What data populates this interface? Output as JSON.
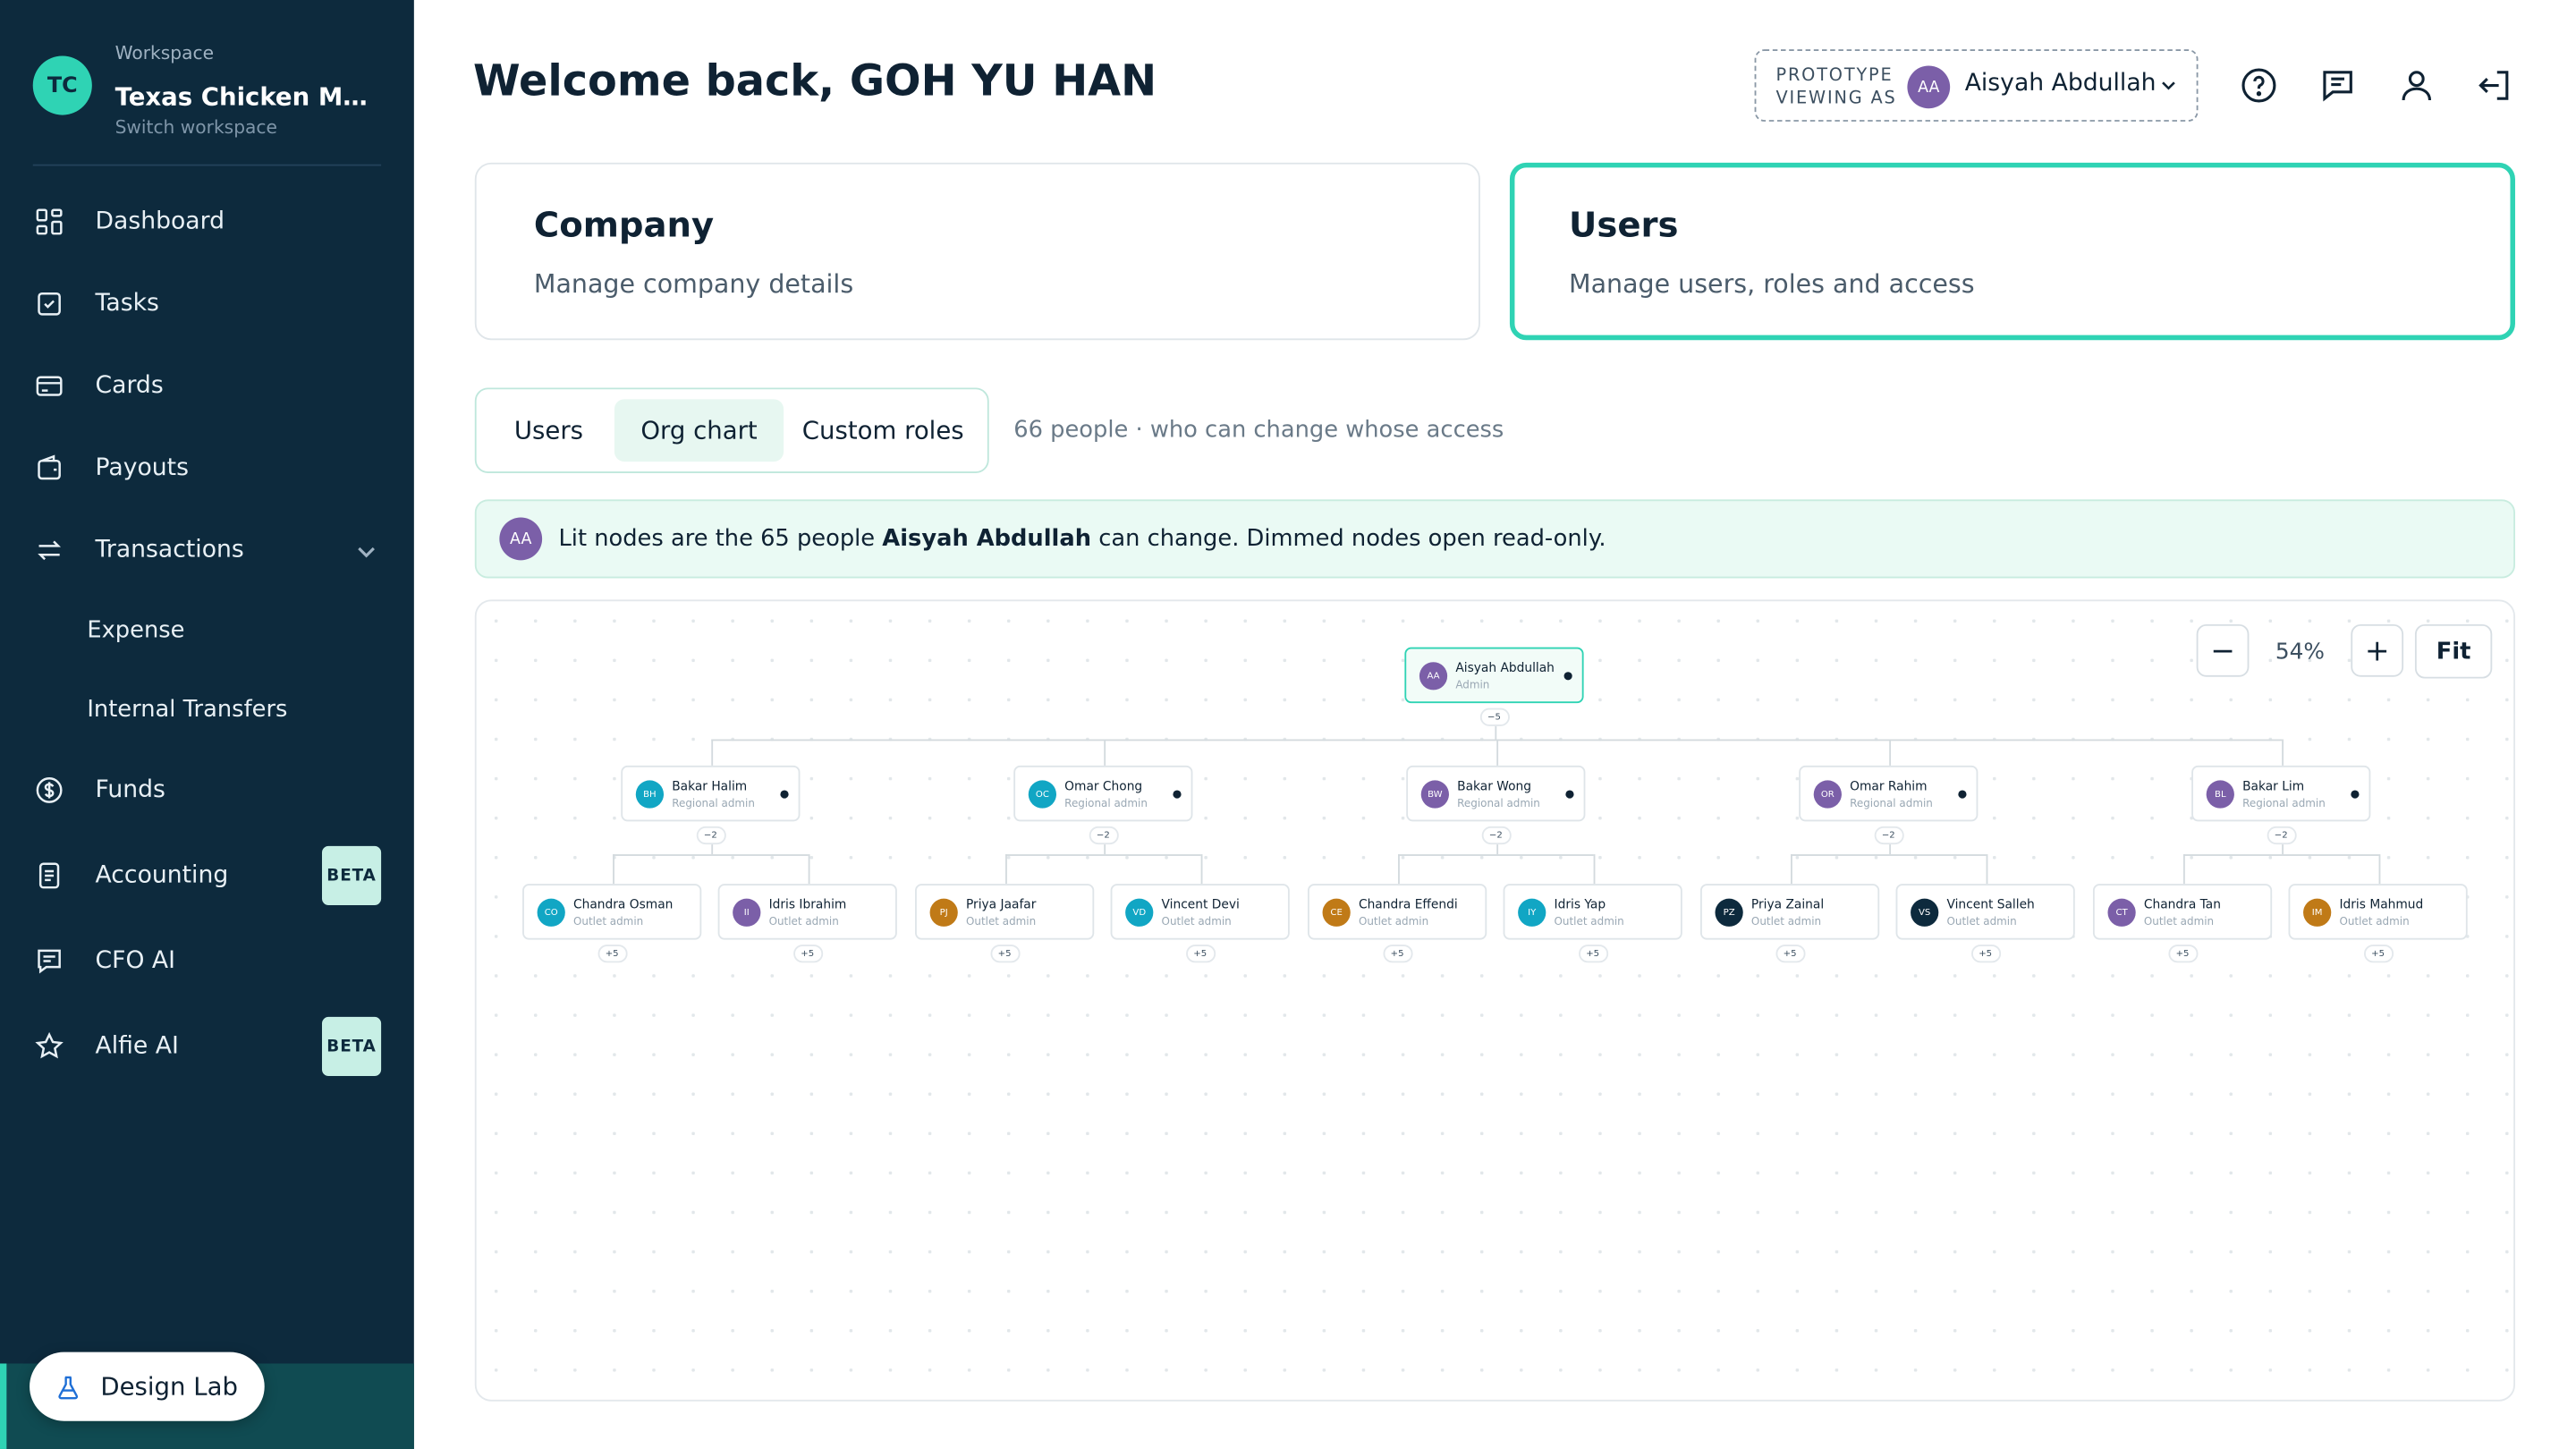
{
  "workspace": {
    "label": "Workspace",
    "name": "Texas Chicken Mala...",
    "switch": "Switch workspace",
    "initials": "TC"
  },
  "nav": {
    "dashboard": "Dashboard",
    "tasks": "Tasks",
    "cards": "Cards",
    "payouts": "Payouts",
    "transactions": "Transactions",
    "expense": "Expense",
    "internal_transfers": "Internal Transfers",
    "funds": "Funds",
    "accounting": "Accounting",
    "cfo_ai": "CFO AI",
    "alfie_ai": "Alfie AI",
    "beta": "BETA"
  },
  "design_lab": "Design Lab",
  "header": {
    "title": "Welcome back, GOH YU HAN"
  },
  "prototype": {
    "label": "PROTOTYPE VIEWING AS",
    "initials": "AA",
    "name": "Aisyah Abdullah"
  },
  "cards": {
    "company": {
      "title": "Company",
      "subtitle": "Manage company details"
    },
    "users": {
      "title": "Users",
      "subtitle": "Manage users, roles and access"
    }
  },
  "tabs": {
    "users": "Users",
    "org_chart": "Org chart",
    "custom_roles": "Custom roles",
    "note": "66 people · who can change whose access"
  },
  "banner": {
    "initials": "AA",
    "pre": "Lit nodes are the 65 people ",
    "name": "Aisyah Abdullah",
    "post": " can change. Dimmed nodes open read-only."
  },
  "zoom": {
    "minus": "−",
    "value": "54%",
    "plus": "+",
    "fit": "Fit"
  },
  "org": {
    "root": {
      "initials": "AA",
      "name": "Aisyah Abdullah",
      "role": "Admin",
      "count": "−5",
      "color": "#7b5fa8"
    },
    "regional": [
      {
        "initials": "BH",
        "name": "Bakar Halim",
        "role": "Regional admin",
        "count": "−2",
        "color": "#11a6c4"
      },
      {
        "initials": "OC",
        "name": "Omar Chong",
        "role": "Regional admin",
        "count": "−2",
        "color": "#11a6c4"
      },
      {
        "initials": "BW",
        "name": "Bakar Wong",
        "role": "Regional admin",
        "count": "−2",
        "color": "#7b5fa8"
      },
      {
        "initials": "OR",
        "name": "Omar Rahim",
        "role": "Regional admin",
        "count": "−2",
        "color": "#7b5fa8"
      },
      {
        "initials": "BL",
        "name": "Bakar Lim",
        "role": "Regional admin",
        "count": "−2",
        "color": "#7b5fa8"
      }
    ],
    "outlets": [
      {
        "initials": "CO",
        "name": "Chandra Osman",
        "role": "Outlet admin",
        "count": "+5",
        "color": "#11a6c4"
      },
      {
        "initials": "II",
        "name": "Idris Ibrahim",
        "role": "Outlet admin",
        "count": "+5",
        "color": "#7b5fa8"
      },
      {
        "initials": "PJ",
        "name": "Priya Jaafar",
        "role": "Outlet admin",
        "count": "+5",
        "color": "#c07a17"
      },
      {
        "initials": "VD",
        "name": "Vincent Devi",
        "role": "Outlet admin",
        "count": "+5",
        "color": "#11a6c4"
      },
      {
        "initials": "CE",
        "name": "Chandra Effendi",
        "role": "Outlet admin",
        "count": "+5",
        "color": "#c07a17"
      },
      {
        "initials": "IY",
        "name": "Idris Yap",
        "role": "Outlet admin",
        "count": "+5",
        "color": "#11a6c4"
      },
      {
        "initials": "PZ",
        "name": "Priya Zainal",
        "role": "Outlet admin",
        "count": "+5",
        "color": "#0d2a3d"
      },
      {
        "initials": "VS",
        "name": "Vincent Salleh",
        "role": "Outlet admin",
        "count": "+5",
        "color": "#0d2a3d"
      },
      {
        "initials": "CT",
        "name": "Chandra Tan",
        "role": "Outlet admin",
        "count": "+5",
        "color": "#7b5fa8"
      },
      {
        "initials": "IM",
        "name": "Idris Mahmud",
        "role": "Outlet admin",
        "count": "+5",
        "color": "#c07a17"
      }
    ]
  }
}
